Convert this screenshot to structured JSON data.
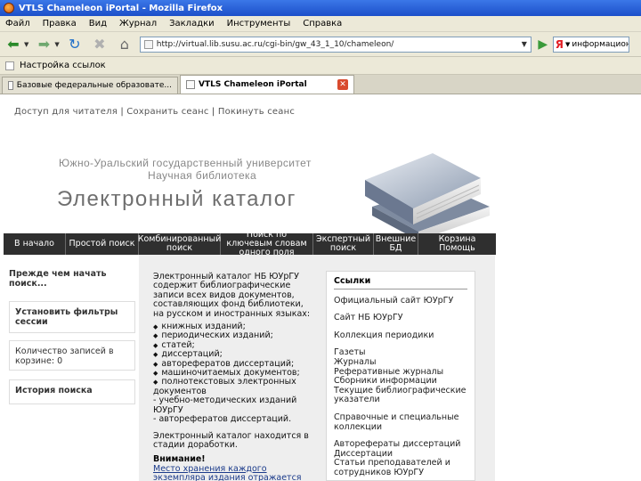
{
  "window": {
    "title": "VTLS Chameleon iPortal - Mozilla Firefox"
  },
  "menu": [
    "Файл",
    "Правка",
    "Вид",
    "Журнал",
    "Закладки",
    "Инструменты",
    "Справка"
  ],
  "toolbar": {
    "url": "http://virtual.lib.susu.ac.ru/cgi-bin/gw_43_1_10/chameleon/",
    "search_engine": "Я",
    "search_value": "информационные"
  },
  "bookmarks": {
    "item": "Настройка ссылок"
  },
  "tabs": [
    {
      "label": "Базовые федеральные образовате...",
      "active": false
    },
    {
      "label": "VTLS Chameleon iPortal",
      "active": true
    }
  ],
  "page": {
    "toplinks": [
      "Доступ для читателя",
      "Сохранить сеанс",
      "Покинуть сеанс"
    ],
    "header_line1": "Южно-Уральский государственный университет",
    "header_line2": "Научная библиотека",
    "title": "Электронный каталог",
    "nav": [
      "В начало",
      "Простой поиск",
      "Комбинированный поиск",
      "Поиск по ключевым словам одного поля",
      "Экспертный поиск",
      "Внешние БД",
      "Корзина Помощь"
    ],
    "left": {
      "intro": "Прежде чем начать поиск...",
      "box1": "Установить фильтры сессии",
      "box2": "Количество записей в корзине: 0",
      "box3": "История поиска"
    },
    "main": {
      "intro": "Электронный каталог НБ ЮУрГУ содержит библиографические записи всех видов документов, составляющих фонд библиотеки, на русском и иностранных языках:",
      "items": [
        "книжных изданий;",
        "периодических изданий;",
        "статей;",
        "диссертаций;",
        "авторефератов диссертаций;",
        "машиночитаемых документов;",
        "полнотекстовых электронных документов"
      ],
      "sub_items": [
        "- учебно-методических изданий ЮУрГУ",
        "- авторефератов диссертаций."
      ],
      "status": "Электронный каталог находится в стадии доработки.",
      "note_title": "Внимание!",
      "note_text": "Место хранения каждого экземпляра издания отражается по"
    },
    "links": {
      "header": "Ссылки",
      "items": [
        "Официальный сайт ЮУрГУ",
        "Сайт НБ ЮУрГУ",
        "Коллекция периодики",
        "Газеты",
        "Журналы",
        "Реферативные журналы",
        "Сборники информации",
        "Текущие библиографические указатели",
        "Справочные и специальные коллекции",
        "Авторефераты диссертаций",
        "Диссертации",
        "Статьи преподавателей и сотрудников ЮУрГУ"
      ]
    }
  }
}
